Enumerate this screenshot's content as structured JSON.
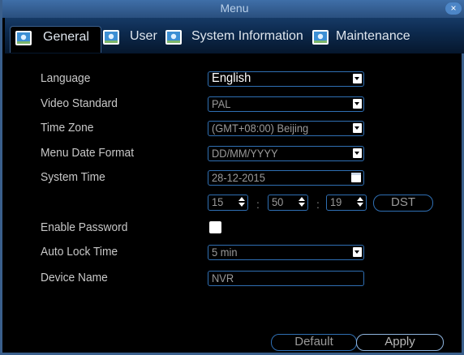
{
  "window": {
    "title": "Menu",
    "close_label": "×"
  },
  "tabs": [
    {
      "label": "General",
      "icon": "monitor-icon",
      "active": true
    },
    {
      "label": "User",
      "icon": "monitor-icon",
      "active": false
    },
    {
      "label": "System Information",
      "icon": "monitor-icon",
      "active": false
    },
    {
      "label": "Maintenance",
      "icon": "monitor-icon",
      "active": false
    }
  ],
  "form": {
    "language": {
      "label": "Language",
      "value": "English"
    },
    "video_standard": {
      "label": "Video Standard",
      "value": "PAL"
    },
    "time_zone": {
      "label": "Time Zone",
      "value": "(GMT+08:00) Beijing"
    },
    "menu_date_format": {
      "label": "Menu Date Format",
      "value": "DD/MM/YYYY"
    },
    "system_time": {
      "label": "System Time",
      "date": "28-12-2015",
      "hour": "15",
      "minute": "50",
      "second": "19",
      "separator": ":",
      "dst_label": "DST"
    },
    "enable_password": {
      "label": "Enable Password",
      "checked": false
    },
    "auto_lock_time": {
      "label": "Auto Lock Time",
      "value": "5 min"
    },
    "device_name": {
      "label": "Device Name",
      "value": "NVR"
    }
  },
  "footer": {
    "default_label": "Default",
    "apply_label": "Apply"
  },
  "colors": {
    "title_bar": "#3f6fa8",
    "field_border": "#2f6fb3",
    "background": "#000000",
    "label_text": "#c8c8c8"
  }
}
